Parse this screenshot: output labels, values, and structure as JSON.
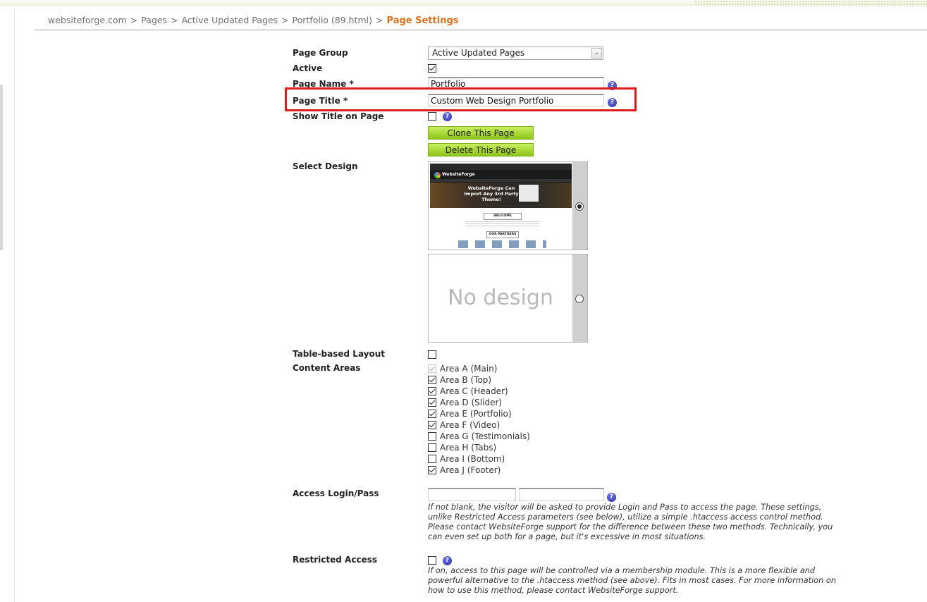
{
  "breadcrumb": {
    "items": [
      "websiteforge.com",
      "Pages",
      "Active Updated Pages",
      "Portfolio (89.html)"
    ],
    "separator": ">",
    "current": "Page Settings"
  },
  "form": {
    "page_group": {
      "label": "Page Group",
      "value": "Active Updated Pages"
    },
    "active": {
      "label": "Active",
      "checked": true
    },
    "page_name": {
      "label": "Page Name *",
      "value": "Portfolio"
    },
    "page_title": {
      "label": "Page Title *",
      "value": "Custom Web Design Portfolio"
    },
    "show_title": {
      "label": "Show Title on Page",
      "checked": false
    },
    "clone_button": "Clone This Page",
    "delete_button": "Delete This Page",
    "select_design": {
      "label": "Select Design",
      "thumbnail": {
        "brand": "WebsiteForge",
        "headline": "WebsiteForge Can Import Any 3rd Party Theme!",
        "welcome": "WELCOME",
        "partners": "OUR PARTNERS"
      },
      "no_design_text": "No design",
      "selected": 0
    },
    "table_layout": {
      "label": "Table-based Layout",
      "checked": false
    },
    "content_areas": {
      "label": "Content Areas",
      "items": [
        {
          "label": "Area A (Main)",
          "checked": true,
          "disabled": true
        },
        {
          "label": "Area B (Top)",
          "checked": true
        },
        {
          "label": "Area C (Header)",
          "checked": true
        },
        {
          "label": "Area D (Slider)",
          "checked": true
        },
        {
          "label": "Area E (Portfolio)",
          "checked": true
        },
        {
          "label": "Area F (Video)",
          "checked": true
        },
        {
          "label": "Area G (Testimonials)",
          "checked": false
        },
        {
          "label": "Area H (Tabs)",
          "checked": false
        },
        {
          "label": "Area I (Bottom)",
          "checked": false
        },
        {
          "label": "Area J (Footer)",
          "checked": true
        }
      ]
    },
    "access": {
      "label": "Access Login/Pass",
      "login_value": "",
      "pass_value": "",
      "hint": "If not blank, the visitor will be asked to provide Login and Pass to access the page. These settings, unlike Restricted Access parameters (see below), utilize a simple .htaccess access control method. Please contact WebsiteForge support for the difference between these two methods. Technically, you can even set up both for a page, but it's excessive in most situations."
    },
    "restricted": {
      "label": "Restricted Access",
      "checked": false,
      "hint": "If on, access to this page will be controlled via a membership module. This is a more flexible and powerful alternative to the .htaccess method (see above). Fits in most cases. For more information on how to use this method, please contact WebsiteForge support."
    }
  },
  "help_icon_glyph": "?",
  "colors": {
    "accent_orange": "#e0701b",
    "button_green": "#a6d83a",
    "highlight_red": "#e01b1b",
    "help_blue": "#3a40c0"
  }
}
